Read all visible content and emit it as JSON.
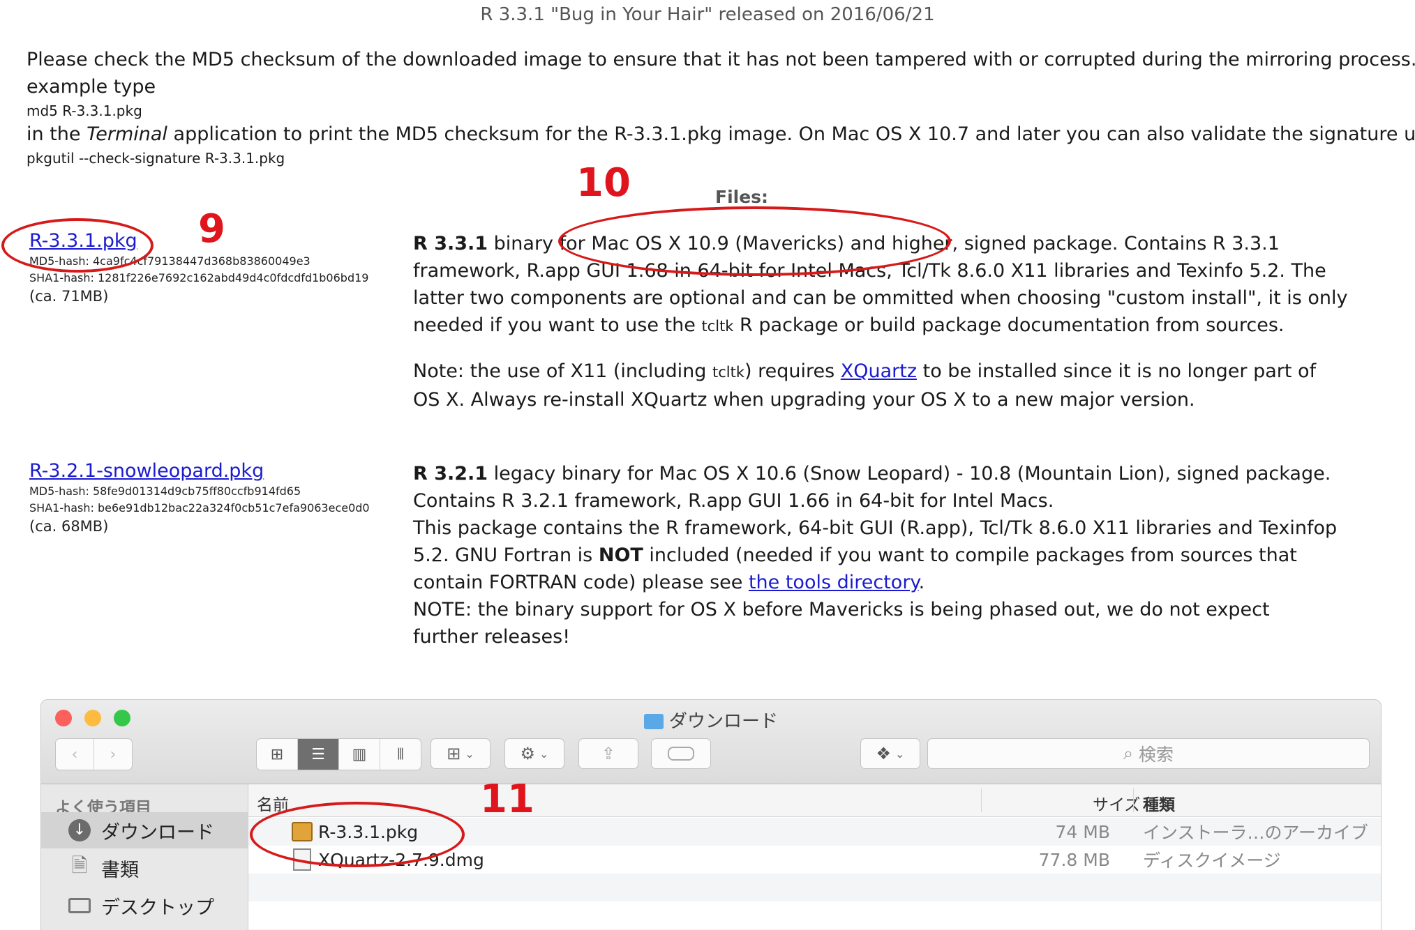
{
  "heading": "R 3.3.1 \"Bug in Your Hair\" released on 2016/06/21",
  "intro": {
    "line1": "Please check the MD5 checksum of the downloaded image to ensure that it has not been tampered with or corrupted during the mirroring process. For",
    "line2": "example type",
    "cmd1": "md5 R-3.3.1.pkg",
    "line3_pre": "in the ",
    "line3_em": "Terminal",
    "line3_post": " application to print the MD5 checksum for the R-3.3.1.pkg image. On Mac OS X 10.7 and later you can also validate the signature using",
    "cmd2": "pkgutil --check-signature R-3.3.1.pkg"
  },
  "files_label": "Files:",
  "annotations": {
    "a9": "9",
    "a10": "10",
    "a11": "11"
  },
  "packages": [
    {
      "name": "R-3.3.1.pkg",
      "md5": "MD5-hash: 4ca9fc4cf79138447d368b83860049e3",
      "sha1": "SHA1-hash: 1281f226e7692c162abd49d4c0fdcdfd1b06bd19",
      "size": "(ca. 71MB)",
      "desc_bold": "R 3.3.1",
      "desc_line1": " binary for Mac OS X 10.9 (Mavericks) and higher, signed package. Contains R 3.3.1",
      "desc_line2": "framework, R.app GUI 1.68 in 64-bit for Intel Macs, Tcl/Tk 8.6.0 X11 libraries and Texinfo 5.2. The",
      "desc_line3": "latter two components are optional and can be ommitted when choosing \"custom install\", it is only",
      "desc_line4_pre": "needed if you want to use the ",
      "desc_line4_code": "tcltk",
      "desc_line4_post": " R package or build package documentation from sources.",
      "note_pre": "Note: the use of X11 (including ",
      "note_code": "tcltk",
      "note_mid": ") requires ",
      "note_link": "XQuartz",
      "note_post": " to be installed since it is no longer part of",
      "note_line2": "OS X. Always re-install XQuartz when upgrading your OS X to a new major version."
    },
    {
      "name": "R-3.2.1-snowleopard.pkg",
      "md5": "MD5-hash: 58fe9d01314d9cb75ff80ccfb914fd65",
      "sha1": "SHA1-hash: be6e91db12bac22a324f0cb51c7efa9063ece0d0",
      "size": "(ca. 68MB)",
      "desc_bold": "R 3.2.1",
      "desc_line1": " legacy binary for Mac OS X 10.6 (Snow Leopard) - 10.8 (Mountain Lion), signed package.",
      "desc_line2": "Contains R 3.2.1 framework, R.app GUI 1.66 in 64-bit for Intel Macs.",
      "desc_line3": "This package contains the R framework, 64-bit GUI (R.app), Tcl/Tk 8.6.0 X11 libraries and Texinfop",
      "desc_line4_pre": "5.2. GNU Fortran is ",
      "desc_line4_bold": "NOT",
      "desc_line4_post": " included (needed if you want to compile packages from sources that",
      "desc_line5_pre": "contain FORTRAN code) please see ",
      "desc_line5_link": "the tools directory",
      "desc_line5_post": ".",
      "desc_line6": "NOTE: the binary support for OS X before Mavericks is being phased out, we do not expect",
      "desc_line7": "further releases!"
    }
  ],
  "finder": {
    "title": "ダウンロード",
    "search_placeholder": "検索",
    "sidebar_heading": "よく使う項目",
    "sidebar_items": [
      "ダウンロード",
      "書類",
      "デスクトップ"
    ],
    "columns": {
      "name": "名前",
      "size": "サイズ",
      "kind": "種類"
    },
    "rows": [
      {
        "name": "R-3.3.1.pkg",
        "size": "74 MB",
        "kind": "インストーラ…のアーカイブ"
      },
      {
        "name": "XQuartz-2.7.9.dmg",
        "size": "77.8 MB",
        "kind": "ディスクイメージ"
      }
    ],
    "colors": {
      "close": "#fc605c",
      "minimize": "#fdbc40",
      "zoom": "#34c84a"
    }
  }
}
